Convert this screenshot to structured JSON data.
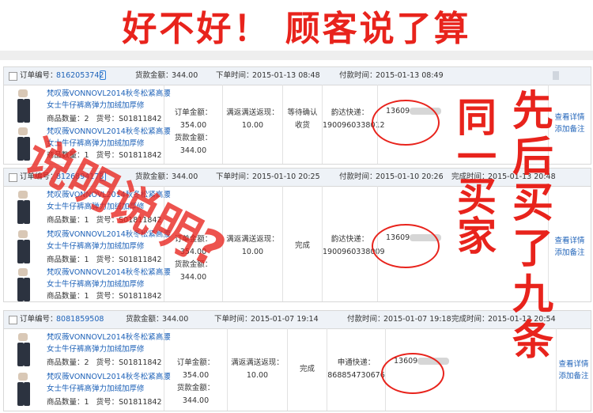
{
  "banner": {
    "title": "好不好！ 顾客说了算"
  },
  "overlay": {
    "left_text": "说明说明?",
    "mid_lines": [
      "同",
      "一",
      "买",
      "家"
    ],
    "right_lines": [
      "先",
      "后",
      "买",
      "了",
      "九",
      "条"
    ]
  },
  "labels": {
    "order_no": "订单编号：",
    "goods_amount": "货款金额：",
    "order_time": "下单时间：",
    "pay_time": "付款时间：",
    "done_time": "完成时间：",
    "qty": "商品数量：",
    "sku": "货号：",
    "order_amount": "订单金额：",
    "goods_amount2": "货款金额：",
    "cashback": "满返满送返现：",
    "view": "查看详情",
    "note": "添加备注",
    "product_title": "梵叹薇VONNOVL2014秋冬松紧高腰女士牛仔裤高弹力加绒加厚修"
  },
  "orders": [
    {
      "no": "8162053742",
      "goods": "344.00",
      "order_time": "2015-01-13 08:48",
      "pay_time": "2015-01-13 08:49",
      "done_time": "",
      "items": [
        {
          "qty": "2",
          "sku": "S01811842"
        },
        {
          "qty": "1",
          "sku": "S01811842"
        }
      ],
      "order_amount": "354.00",
      "goods_amount": "344.00",
      "cashback": "10.00",
      "status_line1": "等待确认",
      "status_line2": "收货",
      "express": "韵达快递：",
      "tracking": "1900960338012",
      "phone": "13609"
    },
    {
      "no": "8126894173",
      "goods": "344.00",
      "order_time": "2015-01-10 20:25",
      "pay_time": "2015-01-10 20:26",
      "done_time": "2015-01-13 20:48",
      "items": [
        {
          "qty": "1",
          "sku": "S01811842"
        },
        {
          "qty": "1",
          "sku": "S01811842"
        },
        {
          "qty": "1",
          "sku": "S01811842"
        }
      ],
      "order_amount": "354.00",
      "goods_amount": "344.00",
      "cashback": "10.00",
      "status_line1": "完成",
      "status_line2": "",
      "express": "韵达快递：",
      "tracking": "1900960338009",
      "phone": "13609"
    },
    {
      "no": "8081859508",
      "goods": "344.00",
      "order_time": "2015-01-07 19:14",
      "pay_time": "2015-01-07 19:18",
      "done_time": "2015-01-13 20:54",
      "items": [
        {
          "qty": "2",
          "sku": "S01811842"
        },
        {
          "qty": "1",
          "sku": "S01811842"
        }
      ],
      "order_amount": "354.00",
      "goods_amount": "344.00",
      "cashback": "10.00",
      "status_line1": "完成",
      "status_line2": "",
      "express": "申通快递：",
      "tracking": "868854730676",
      "phone": "13609"
    }
  ]
}
